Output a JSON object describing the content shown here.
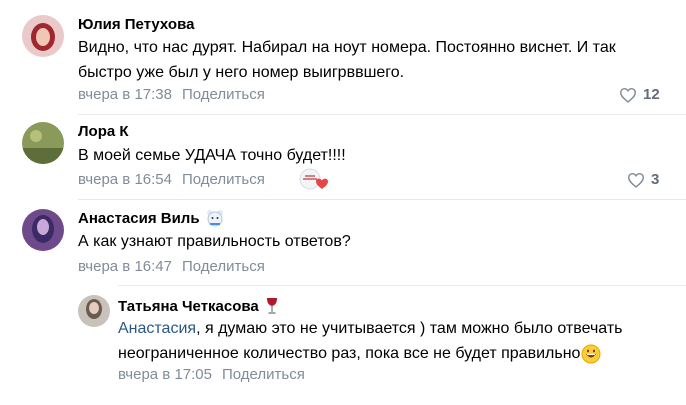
{
  "comments": [
    {
      "author": "Юлия Петухова",
      "text_lines": [
        "Видно, что нас дурят. Набирал на ноут номера. Постоянно виснет. И так",
        "быстро уже был у него номер выигрввшего."
      ],
      "time": "вчера в 17:38",
      "share": "Поделиться",
      "likes": "12"
    },
    {
      "author": "Лора К",
      "text_lines": [
        "В моей семье УДАЧА точно будет!!!!"
      ],
      "time": "вчера в 16:54",
      "share": "Поделиться",
      "likes": "3"
    },
    {
      "author": "Анастасия Виль",
      "text_lines": [
        "А как узнают правильность ответов?"
      ],
      "time": "вчера в 16:47",
      "share": "Поделиться"
    }
  ],
  "reply": {
    "author": "Татьяна Четкасова",
    "mention": "Анастасия",
    "text_line1_rest": ", я думаю это не учитывается ) там можно было отвечать",
    "text_line2": "неограниченное количество раз, пока все не будет правильно",
    "time": "вчера в 17:05",
    "share": "Поделиться"
  },
  "colors": {
    "meta": "#818c99",
    "mention": "#2a5885",
    "heart": "#e64646"
  }
}
